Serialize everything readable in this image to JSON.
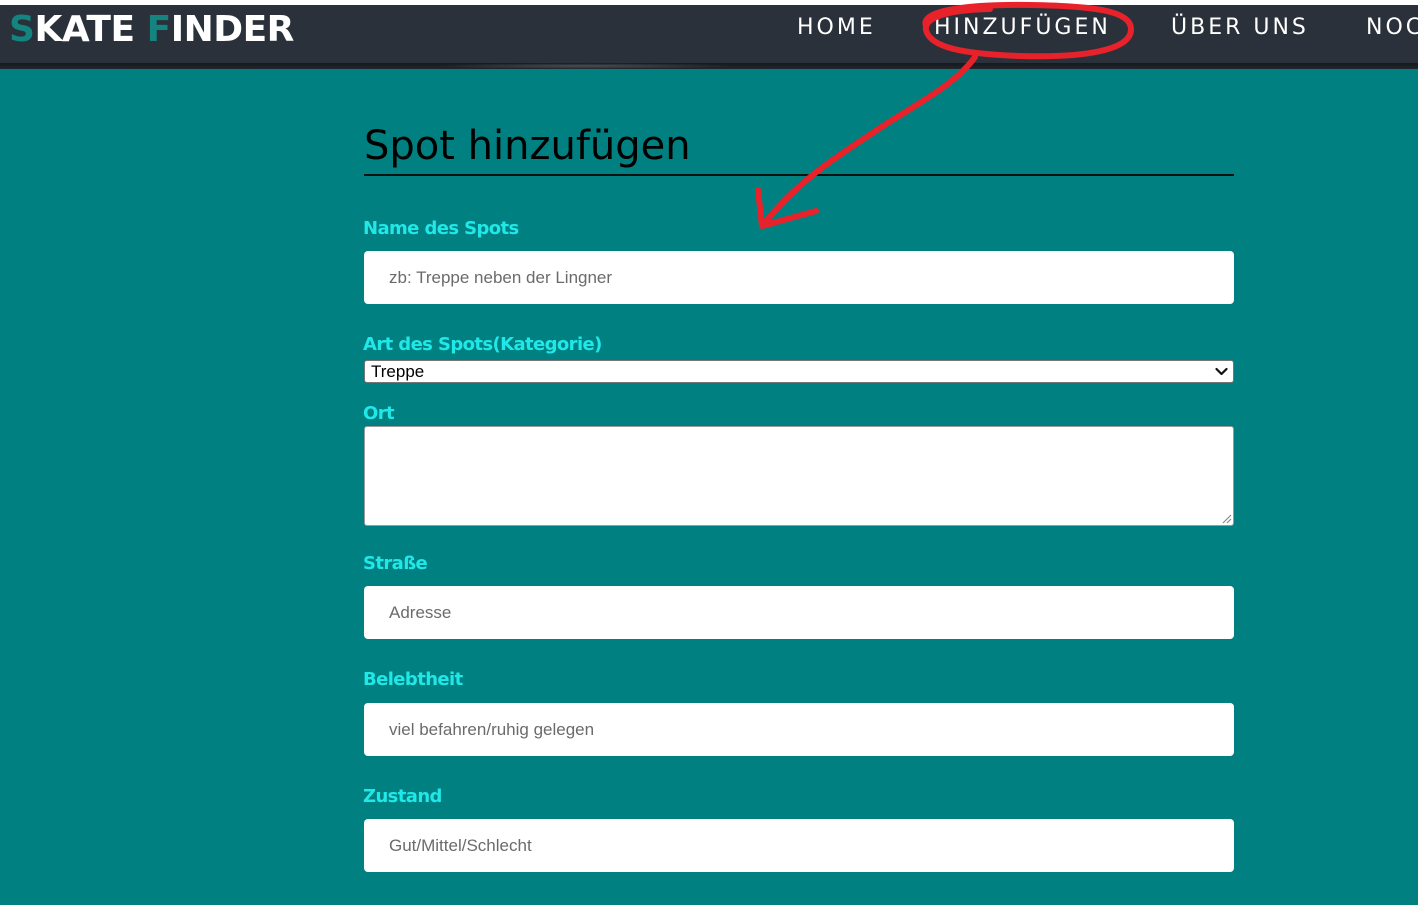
{
  "navbar": {
    "brand": {
      "first_initial": "S",
      "first_rest": "KATE ",
      "second_initial": "F",
      "second_rest": "INDER"
    },
    "items": [
      {
        "label": "HOME"
      },
      {
        "label": "HINZUFÜGEN"
      },
      {
        "label": "ÜBER UNS"
      },
      {
        "label": "NOC"
      }
    ]
  },
  "form": {
    "title": "Spot hinzufügen",
    "name": {
      "label": "Name des Spots",
      "placeholder": "zb: Treppe neben der Lingner",
      "value": ""
    },
    "category": {
      "label": "Art des Spots(Kategorie)",
      "selected": "Treppe"
    },
    "location": {
      "label": "Ort",
      "value": ""
    },
    "street": {
      "label": "Straße",
      "placeholder": "Adresse",
      "value": ""
    },
    "busyness": {
      "label": "Belebtheit",
      "placeholder": "viel befahren/ruhig gelegen",
      "value": ""
    },
    "condition": {
      "label": "Zustand",
      "placeholder": "Gut/Mittel/Schlecht",
      "value": ""
    }
  },
  "colors": {
    "page_background": "#008080",
    "navbar_background": "#2b313a",
    "brand_accent": "#13847f",
    "label_color": "#20e8e8",
    "annotation": "#e8222a"
  },
  "icons": {
    "select_arrow": "chevron-down-icon",
    "resize_grip": "resize-grip-icon"
  },
  "annotation": {
    "type": "hand-drawn red circle around HINZUFÜGEN with arrow pointing to form"
  }
}
